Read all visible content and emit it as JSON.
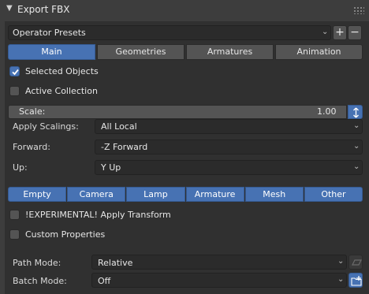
{
  "header": {
    "title": "Export FBX",
    "collapse_icon": "triangle-down-icon",
    "grip_icon": "drag-grip-icon"
  },
  "presets": {
    "label": "Operator Presets",
    "add_label": "+",
    "remove_label": "−"
  },
  "tabs": [
    {
      "label": "Main",
      "active": true
    },
    {
      "label": "Geometries",
      "active": false
    },
    {
      "label": "Armatures",
      "active": false
    },
    {
      "label": "Animation",
      "active": false
    }
  ],
  "options": {
    "selected_objects": {
      "label": "Selected Objects",
      "checked": true
    },
    "active_collection": {
      "label": "Active Collection",
      "checked": false
    }
  },
  "scale": {
    "label": "Scale:",
    "value": "1.00"
  },
  "fields": {
    "apply_scalings": {
      "label": "Apply Scalings:",
      "value": "All Local"
    },
    "forward": {
      "label": "Forward:",
      "value": "-Z Forward"
    },
    "up": {
      "label": "Up:",
      "value": "Y Up"
    }
  },
  "object_types": [
    "Empty",
    "Camera",
    "Lamp",
    "Armature",
    "Mesh",
    "Other"
  ],
  "options2": {
    "apply_transform": {
      "label": "!EXPERIMENTAL! Apply Transform",
      "checked": false
    },
    "custom_properties": {
      "label": "Custom Properties",
      "checked": false
    }
  },
  "path_mode": {
    "label": "Path Mode:",
    "value": "Relative",
    "icon": "embed-textures-icon"
  },
  "batch_mode": {
    "label": "Batch Mode:",
    "value": "Off",
    "icon": "new-folder-icon"
  },
  "colors": {
    "accent": "#4772b3",
    "panel": "#303030",
    "field": "#2b2b2b",
    "button": "#545454"
  }
}
